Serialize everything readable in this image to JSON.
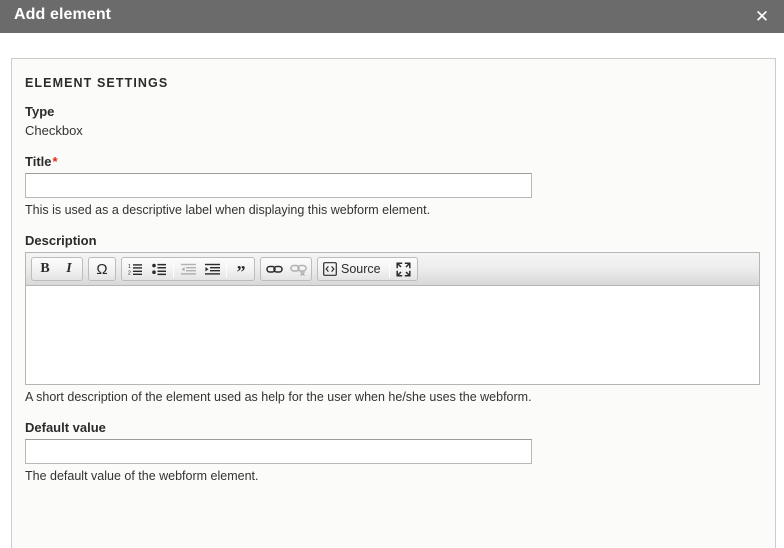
{
  "dialog": {
    "title": "Add element",
    "close_label": "✕",
    "close_icon": "close-icon"
  },
  "panel": {
    "legend": "ELEMENT SETTINGS"
  },
  "fields": {
    "type": {
      "label": "Type",
      "value": "Checkbox"
    },
    "title": {
      "label": "Title",
      "required_marker": "*",
      "value": "",
      "placeholder": "",
      "description": "This is used as a descriptive label when displaying this webform element."
    },
    "description": {
      "label": "Description",
      "value": "",
      "description": "A short description of the element used as help for the user when he/she uses the webform."
    },
    "default_value": {
      "label": "Default value",
      "value": "",
      "placeholder": "",
      "description": "The default value of the webform element."
    }
  },
  "editor_toolbar": {
    "groups": [
      {
        "name": "basic-styles",
        "buttons": [
          {
            "name": "bold-icon",
            "label": "B",
            "kind": "glyph-bold",
            "disabled": false
          },
          {
            "name": "italic-icon",
            "label": "I",
            "kind": "glyph-italic",
            "disabled": false
          }
        ]
      },
      {
        "name": "special-char",
        "buttons": [
          {
            "name": "special-character-icon",
            "label": "Ω",
            "kind": "glyph-omega",
            "disabled": false
          }
        ]
      },
      {
        "name": "paragraph",
        "buttons": [
          {
            "name": "numbered-list-icon",
            "label": "",
            "kind": "numbered-list",
            "disabled": false
          },
          {
            "name": "bulleted-list-icon",
            "label": "",
            "kind": "bulleted-list",
            "disabled": false
          },
          {
            "name": "separator",
            "label": "",
            "kind": "separator",
            "disabled": false
          },
          {
            "name": "outdent-icon",
            "label": "",
            "kind": "outdent",
            "disabled": true
          },
          {
            "name": "indent-icon",
            "label": "",
            "kind": "indent",
            "disabled": false
          },
          {
            "name": "separator",
            "label": "",
            "kind": "separator",
            "disabled": false
          },
          {
            "name": "blockquote-icon",
            "label": "”",
            "kind": "glyph-quote",
            "disabled": false
          }
        ]
      },
      {
        "name": "links",
        "buttons": [
          {
            "name": "link-icon",
            "label": "",
            "kind": "link",
            "disabled": false
          },
          {
            "name": "unlink-icon",
            "label": "",
            "kind": "unlink",
            "disabled": true
          }
        ]
      },
      {
        "name": "tools",
        "buttons": [
          {
            "name": "source-button",
            "label": "Source",
            "kind": "source",
            "disabled": false
          },
          {
            "name": "separator",
            "label": "",
            "kind": "separator",
            "disabled": false
          },
          {
            "name": "maximize-icon",
            "label": "",
            "kind": "maximize",
            "disabled": false
          }
        ]
      }
    ],
    "source_label": "Source"
  },
  "colors": {
    "header_bar": "#6b6b6b",
    "panel_background": "#fbfbf9",
    "panel_border": "#cccccc",
    "required_marker": "#e02a10",
    "text": "#333333",
    "toolbar_top": "#f4f4f4",
    "toolbar_bottom": "#d8d8d8"
  }
}
